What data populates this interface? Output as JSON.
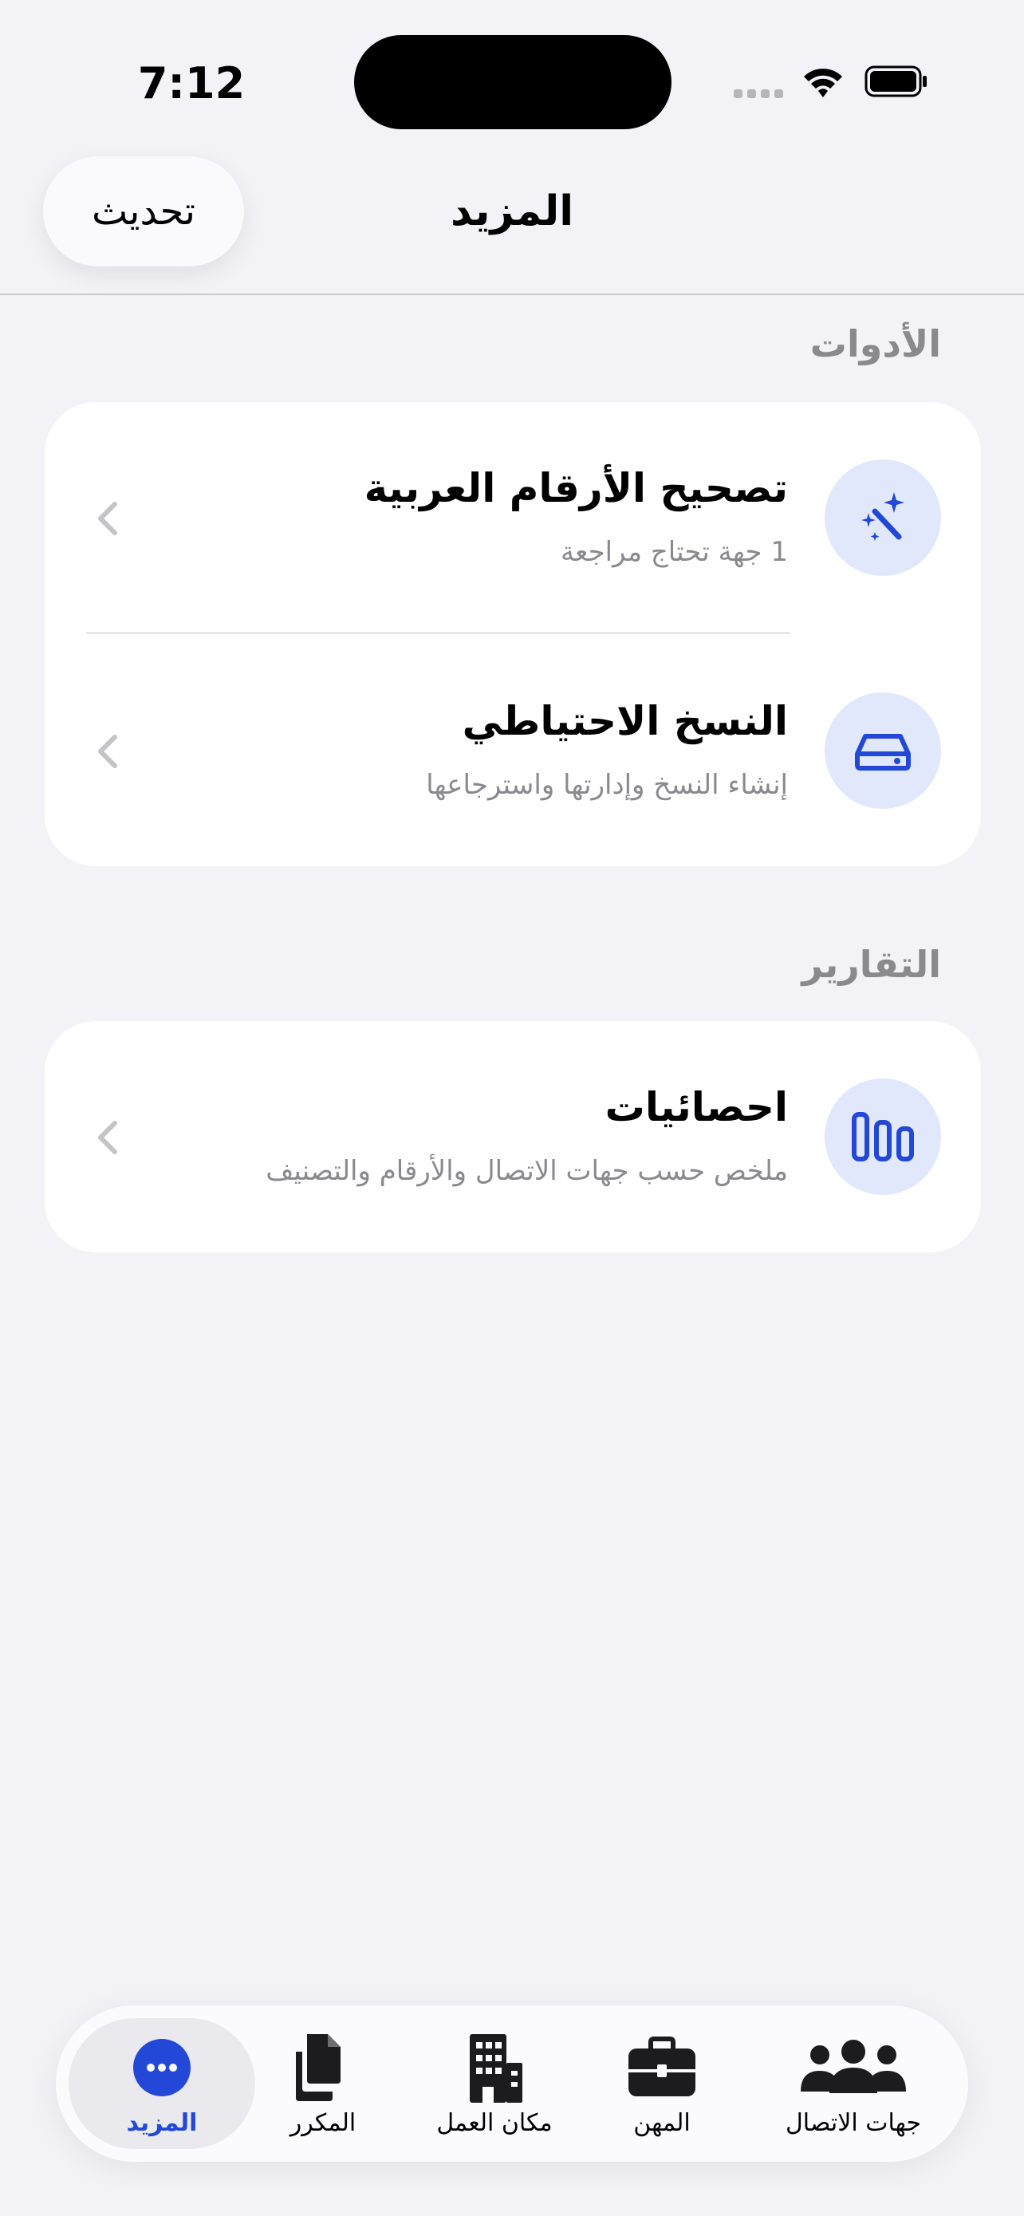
{
  "status_bar": {
    "time": "7:12"
  },
  "nav": {
    "title": "المزيد",
    "refresh_label": "تحديث"
  },
  "sections": [
    {
      "header": "الأدوات",
      "items": [
        {
          "title": "تصحيح الأرقام العربية",
          "subtitle": "1 جهة تحتاج مراجعة",
          "icon": "magic-wand-icon"
        },
        {
          "title": "النسخ الاحتياطي",
          "subtitle": "إنشاء النسخ وإدارتها واسترجاعها",
          "icon": "hard-drive-icon"
        }
      ]
    },
    {
      "header": "التقارير",
      "items": [
        {
          "title": "احصائيات",
          "subtitle": "ملخص حسب جهات الاتصال والأرقام والتصنيف",
          "icon": "stats-bars-icon"
        }
      ]
    }
  ],
  "tab_bar": {
    "active": "المزيد",
    "tabs": [
      {
        "label": "المزيد",
        "icon": "more-icon"
      },
      {
        "label": "المكرر",
        "icon": "duplicate-docs-icon"
      },
      {
        "label": "مكان العمل",
        "icon": "building-icon"
      },
      {
        "label": "المهن",
        "icon": "briefcase-icon"
      },
      {
        "label": "جهات الاتصال",
        "icon": "people-icon"
      }
    ]
  },
  "colors": {
    "accent": "#2348d8",
    "icon_bg": "#e1e8fb",
    "background": "#f2f2f7"
  }
}
